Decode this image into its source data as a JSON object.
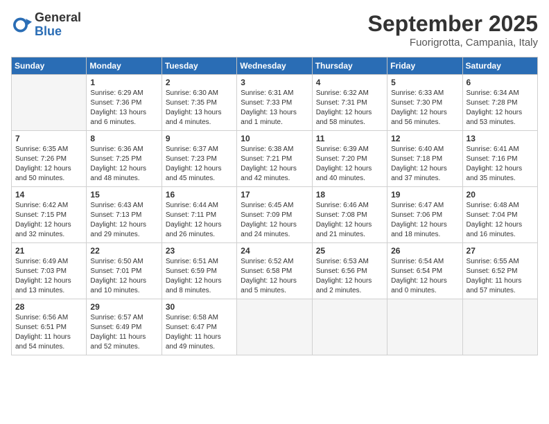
{
  "logo": {
    "general": "General",
    "blue": "Blue"
  },
  "title": "September 2025",
  "location": "Fuorigrotta, Campania, Italy",
  "days_of_week": [
    "Sunday",
    "Monday",
    "Tuesday",
    "Wednesday",
    "Thursday",
    "Friday",
    "Saturday"
  ],
  "weeks": [
    [
      {
        "day": null,
        "info": null
      },
      {
        "day": "1",
        "info": "Sunrise: 6:29 AM\nSunset: 7:36 PM\nDaylight: 13 hours\nand 6 minutes."
      },
      {
        "day": "2",
        "info": "Sunrise: 6:30 AM\nSunset: 7:35 PM\nDaylight: 13 hours\nand 4 minutes."
      },
      {
        "day": "3",
        "info": "Sunrise: 6:31 AM\nSunset: 7:33 PM\nDaylight: 13 hours\nand 1 minute."
      },
      {
        "day": "4",
        "info": "Sunrise: 6:32 AM\nSunset: 7:31 PM\nDaylight: 12 hours\nand 58 minutes."
      },
      {
        "day": "5",
        "info": "Sunrise: 6:33 AM\nSunset: 7:30 PM\nDaylight: 12 hours\nand 56 minutes."
      },
      {
        "day": "6",
        "info": "Sunrise: 6:34 AM\nSunset: 7:28 PM\nDaylight: 12 hours\nand 53 minutes."
      }
    ],
    [
      {
        "day": "7",
        "info": "Sunrise: 6:35 AM\nSunset: 7:26 PM\nDaylight: 12 hours\nand 50 minutes."
      },
      {
        "day": "8",
        "info": "Sunrise: 6:36 AM\nSunset: 7:25 PM\nDaylight: 12 hours\nand 48 minutes."
      },
      {
        "day": "9",
        "info": "Sunrise: 6:37 AM\nSunset: 7:23 PM\nDaylight: 12 hours\nand 45 minutes."
      },
      {
        "day": "10",
        "info": "Sunrise: 6:38 AM\nSunset: 7:21 PM\nDaylight: 12 hours\nand 42 minutes."
      },
      {
        "day": "11",
        "info": "Sunrise: 6:39 AM\nSunset: 7:20 PM\nDaylight: 12 hours\nand 40 minutes."
      },
      {
        "day": "12",
        "info": "Sunrise: 6:40 AM\nSunset: 7:18 PM\nDaylight: 12 hours\nand 37 minutes."
      },
      {
        "day": "13",
        "info": "Sunrise: 6:41 AM\nSunset: 7:16 PM\nDaylight: 12 hours\nand 35 minutes."
      }
    ],
    [
      {
        "day": "14",
        "info": "Sunrise: 6:42 AM\nSunset: 7:15 PM\nDaylight: 12 hours\nand 32 minutes."
      },
      {
        "day": "15",
        "info": "Sunrise: 6:43 AM\nSunset: 7:13 PM\nDaylight: 12 hours\nand 29 minutes."
      },
      {
        "day": "16",
        "info": "Sunrise: 6:44 AM\nSunset: 7:11 PM\nDaylight: 12 hours\nand 26 minutes."
      },
      {
        "day": "17",
        "info": "Sunrise: 6:45 AM\nSunset: 7:09 PM\nDaylight: 12 hours\nand 24 minutes."
      },
      {
        "day": "18",
        "info": "Sunrise: 6:46 AM\nSunset: 7:08 PM\nDaylight: 12 hours\nand 21 minutes."
      },
      {
        "day": "19",
        "info": "Sunrise: 6:47 AM\nSunset: 7:06 PM\nDaylight: 12 hours\nand 18 minutes."
      },
      {
        "day": "20",
        "info": "Sunrise: 6:48 AM\nSunset: 7:04 PM\nDaylight: 12 hours\nand 16 minutes."
      }
    ],
    [
      {
        "day": "21",
        "info": "Sunrise: 6:49 AM\nSunset: 7:03 PM\nDaylight: 12 hours\nand 13 minutes."
      },
      {
        "day": "22",
        "info": "Sunrise: 6:50 AM\nSunset: 7:01 PM\nDaylight: 12 hours\nand 10 minutes."
      },
      {
        "day": "23",
        "info": "Sunrise: 6:51 AM\nSunset: 6:59 PM\nDaylight: 12 hours\nand 8 minutes."
      },
      {
        "day": "24",
        "info": "Sunrise: 6:52 AM\nSunset: 6:58 PM\nDaylight: 12 hours\nand 5 minutes."
      },
      {
        "day": "25",
        "info": "Sunrise: 6:53 AM\nSunset: 6:56 PM\nDaylight: 12 hours\nand 2 minutes."
      },
      {
        "day": "26",
        "info": "Sunrise: 6:54 AM\nSunset: 6:54 PM\nDaylight: 12 hours\nand 0 minutes."
      },
      {
        "day": "27",
        "info": "Sunrise: 6:55 AM\nSunset: 6:52 PM\nDaylight: 11 hours\nand 57 minutes."
      }
    ],
    [
      {
        "day": "28",
        "info": "Sunrise: 6:56 AM\nSunset: 6:51 PM\nDaylight: 11 hours\nand 54 minutes."
      },
      {
        "day": "29",
        "info": "Sunrise: 6:57 AM\nSunset: 6:49 PM\nDaylight: 11 hours\nand 52 minutes."
      },
      {
        "day": "30",
        "info": "Sunrise: 6:58 AM\nSunset: 6:47 PM\nDaylight: 11 hours\nand 49 minutes."
      },
      {
        "day": null,
        "info": null
      },
      {
        "day": null,
        "info": null
      },
      {
        "day": null,
        "info": null
      },
      {
        "day": null,
        "info": null
      }
    ]
  ]
}
